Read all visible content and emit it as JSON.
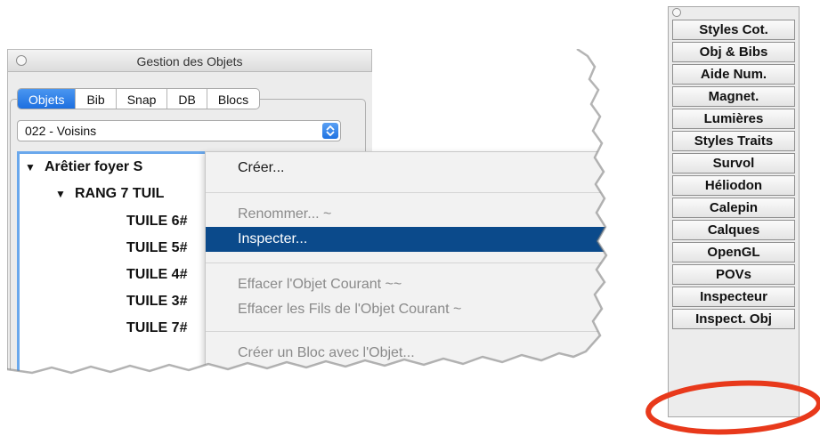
{
  "window": {
    "title": "Gestion des Objets",
    "tabs": [
      {
        "label": "Objets",
        "active": true
      },
      {
        "label": "Bib",
        "active": false
      },
      {
        "label": "Snap",
        "active": false
      },
      {
        "label": "DB",
        "active": false
      },
      {
        "label": "Blocs",
        "active": false
      }
    ],
    "select_value": "022 - Voisins",
    "tree": [
      {
        "label": "Arêtier foyer S",
        "expanded": true
      },
      {
        "label": "RANG 7 TUIL",
        "expanded": true
      },
      {
        "label": "TUILE 6#"
      },
      {
        "label": "TUILE 5#"
      },
      {
        "label": "TUILE 4#"
      },
      {
        "label": "TUILE 3#"
      },
      {
        "label": "TUILE 7#"
      }
    ]
  },
  "context_menu": {
    "items": [
      {
        "label": "Créer...",
        "state": "enabled"
      },
      {
        "label": "Renommer... ~",
        "state": "disabled"
      },
      {
        "label": "Inspecter...",
        "state": "selected"
      },
      {
        "label": "Effacer l'Objet Courant ~~",
        "state": "disabled"
      },
      {
        "label": "Effacer les Fils de l'Objet Courant ~",
        "state": "disabled"
      },
      {
        "label": "Créer un Bloc avec l'Objet...",
        "state": "disabled"
      }
    ]
  },
  "palette": {
    "buttons": [
      "Styles Cot.",
      "Obj & Bibs",
      "Aide Num.",
      "Magnet.",
      "Lumières",
      "Styles Traits",
      "Survol",
      "Héliodon",
      "Calepin",
      "Calques",
      "OpenGL",
      "POVs",
      "Inspecteur",
      "Inspect. Obj"
    ],
    "highlighted": "Inspect. Obj"
  },
  "colors": {
    "selection": "#0b4a8b",
    "tab_active": "#1d6fe0",
    "highlight_ring": "#e8391b"
  }
}
